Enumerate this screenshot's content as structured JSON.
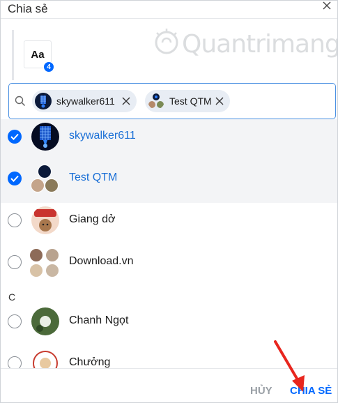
{
  "dialog": {
    "title": "Chia sẻ",
    "watermark": "Quantrimang"
  },
  "preview": {
    "text": "Aa",
    "count": "4"
  },
  "search": {
    "chips": [
      {
        "label": "skywalker611"
      },
      {
        "label": "Test QTM"
      }
    ]
  },
  "contacts": {
    "items": [
      {
        "name": "skywalker611",
        "checked": true
      },
      {
        "name": "Test QTM",
        "checked": true
      },
      {
        "name": "Giang dở",
        "checked": false
      },
      {
        "name": "Download.vn",
        "checked": false
      }
    ],
    "section_letter": "C",
    "items_c": [
      {
        "name": "Chanh Ngọt",
        "checked": false
      },
      {
        "name": "Chưởng",
        "checked": false
      }
    ]
  },
  "footer": {
    "cancel_label": "HỦY",
    "share_label": "CHIA SẺ"
  },
  "colors": {
    "accent": "#0068ff",
    "selected_text": "#1a6fd6",
    "arrow": "#e8261e"
  }
}
